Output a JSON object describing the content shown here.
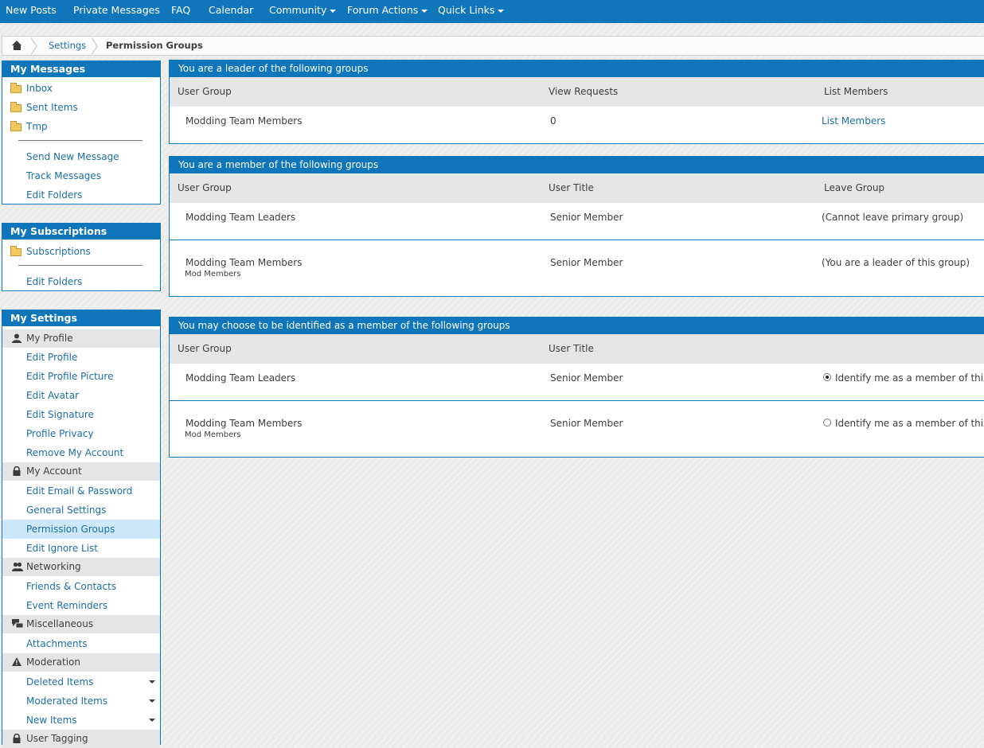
{
  "topnav": {
    "items": [
      {
        "label": "New Posts"
      },
      {
        "label": "Private Messages"
      },
      {
        "label": "FAQ"
      },
      {
        "label": "Calendar"
      },
      {
        "label": "Community"
      },
      {
        "label": "Forum Actions"
      },
      {
        "label": "Quick Links"
      }
    ]
  },
  "breadcrumb": {
    "settings": "Settings",
    "current": "Permission Groups"
  },
  "sidebar": {
    "messages": {
      "title": "My Messages",
      "folders": [
        "Inbox",
        "Sent Items",
        "Tmp"
      ],
      "links": [
        "Send New Message",
        "Track Messages",
        "Edit Folders"
      ]
    },
    "subscriptions": {
      "title": "My Subscriptions",
      "folders": [
        "Subscriptions"
      ],
      "links": [
        "Edit Folders"
      ]
    },
    "settings": {
      "title": "My Settings",
      "profile": {
        "label": "My Profile",
        "items": [
          "Edit Profile",
          "Edit Profile Picture",
          "Edit Avatar",
          "Edit Signature",
          "Profile Privacy",
          "Remove My Account"
        ]
      },
      "account": {
        "label": "My Account",
        "items": [
          "Edit Email & Password",
          "General Settings",
          "Permission Groups",
          "Edit Ignore List"
        ]
      },
      "networking": {
        "label": "Networking",
        "items": [
          "Friends & Contacts",
          "Event Reminders"
        ]
      },
      "misc": {
        "label": "Miscellaneous",
        "items": [
          "Attachments"
        ]
      },
      "moderation": {
        "label": "Moderation",
        "items": [
          "Deleted Items",
          "Moderated Items",
          "New Items"
        ]
      },
      "tagging": {
        "label": "User Tagging"
      }
    }
  },
  "leader": {
    "title": "You are a leader of the following groups",
    "headers": [
      "User Group",
      "View Requests",
      "List Members"
    ],
    "rows": [
      {
        "group": "Modding Team Members",
        "requests": "0",
        "action": "List Members"
      }
    ]
  },
  "member": {
    "title": "You are a member of the following groups",
    "headers": [
      "User Group",
      "User Title",
      "Leave Group"
    ],
    "rows": [
      {
        "group": "Modding Team Leaders",
        "sub": "",
        "title": "Senior Member",
        "leave": "(Cannot leave primary group)"
      },
      {
        "group": "Modding Team Members",
        "sub": "Mod Members",
        "title": "Senior Member",
        "leave": "(You are a leader of this group)"
      }
    ]
  },
  "identify": {
    "title": "You may choose to be identified as a member of the following groups",
    "headers": [
      "User Group",
      "User Title"
    ],
    "rows": [
      {
        "group": "Modding Team Leaders",
        "sub": "",
        "title": "Senior Member",
        "option": "Identify me as a member of this group",
        "checked": true
      },
      {
        "group": "Modding Team Members",
        "sub": "Mod Members",
        "title": "Senior Member",
        "option": "Identify me as a member of this group",
        "checked": false
      }
    ]
  },
  "colors": {
    "accent": "#0f76bb",
    "link": "#1c6ea4",
    "active_bg": "#cde8fa"
  }
}
